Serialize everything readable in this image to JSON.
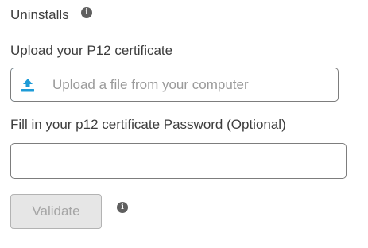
{
  "uninstalls": {
    "title": "Uninstalls",
    "info_icon": "info-icon"
  },
  "upload": {
    "label": "Upload your P12 certificate",
    "placeholder": "Upload a file from your computer",
    "button_icon": "upload-icon",
    "accent_color": "#1e9bd7"
  },
  "password": {
    "label": "Fill in your p12 certificate Password (Optional)",
    "value": ""
  },
  "validate": {
    "label": "Validate",
    "disabled": true,
    "info_icon": "info-icon"
  }
}
